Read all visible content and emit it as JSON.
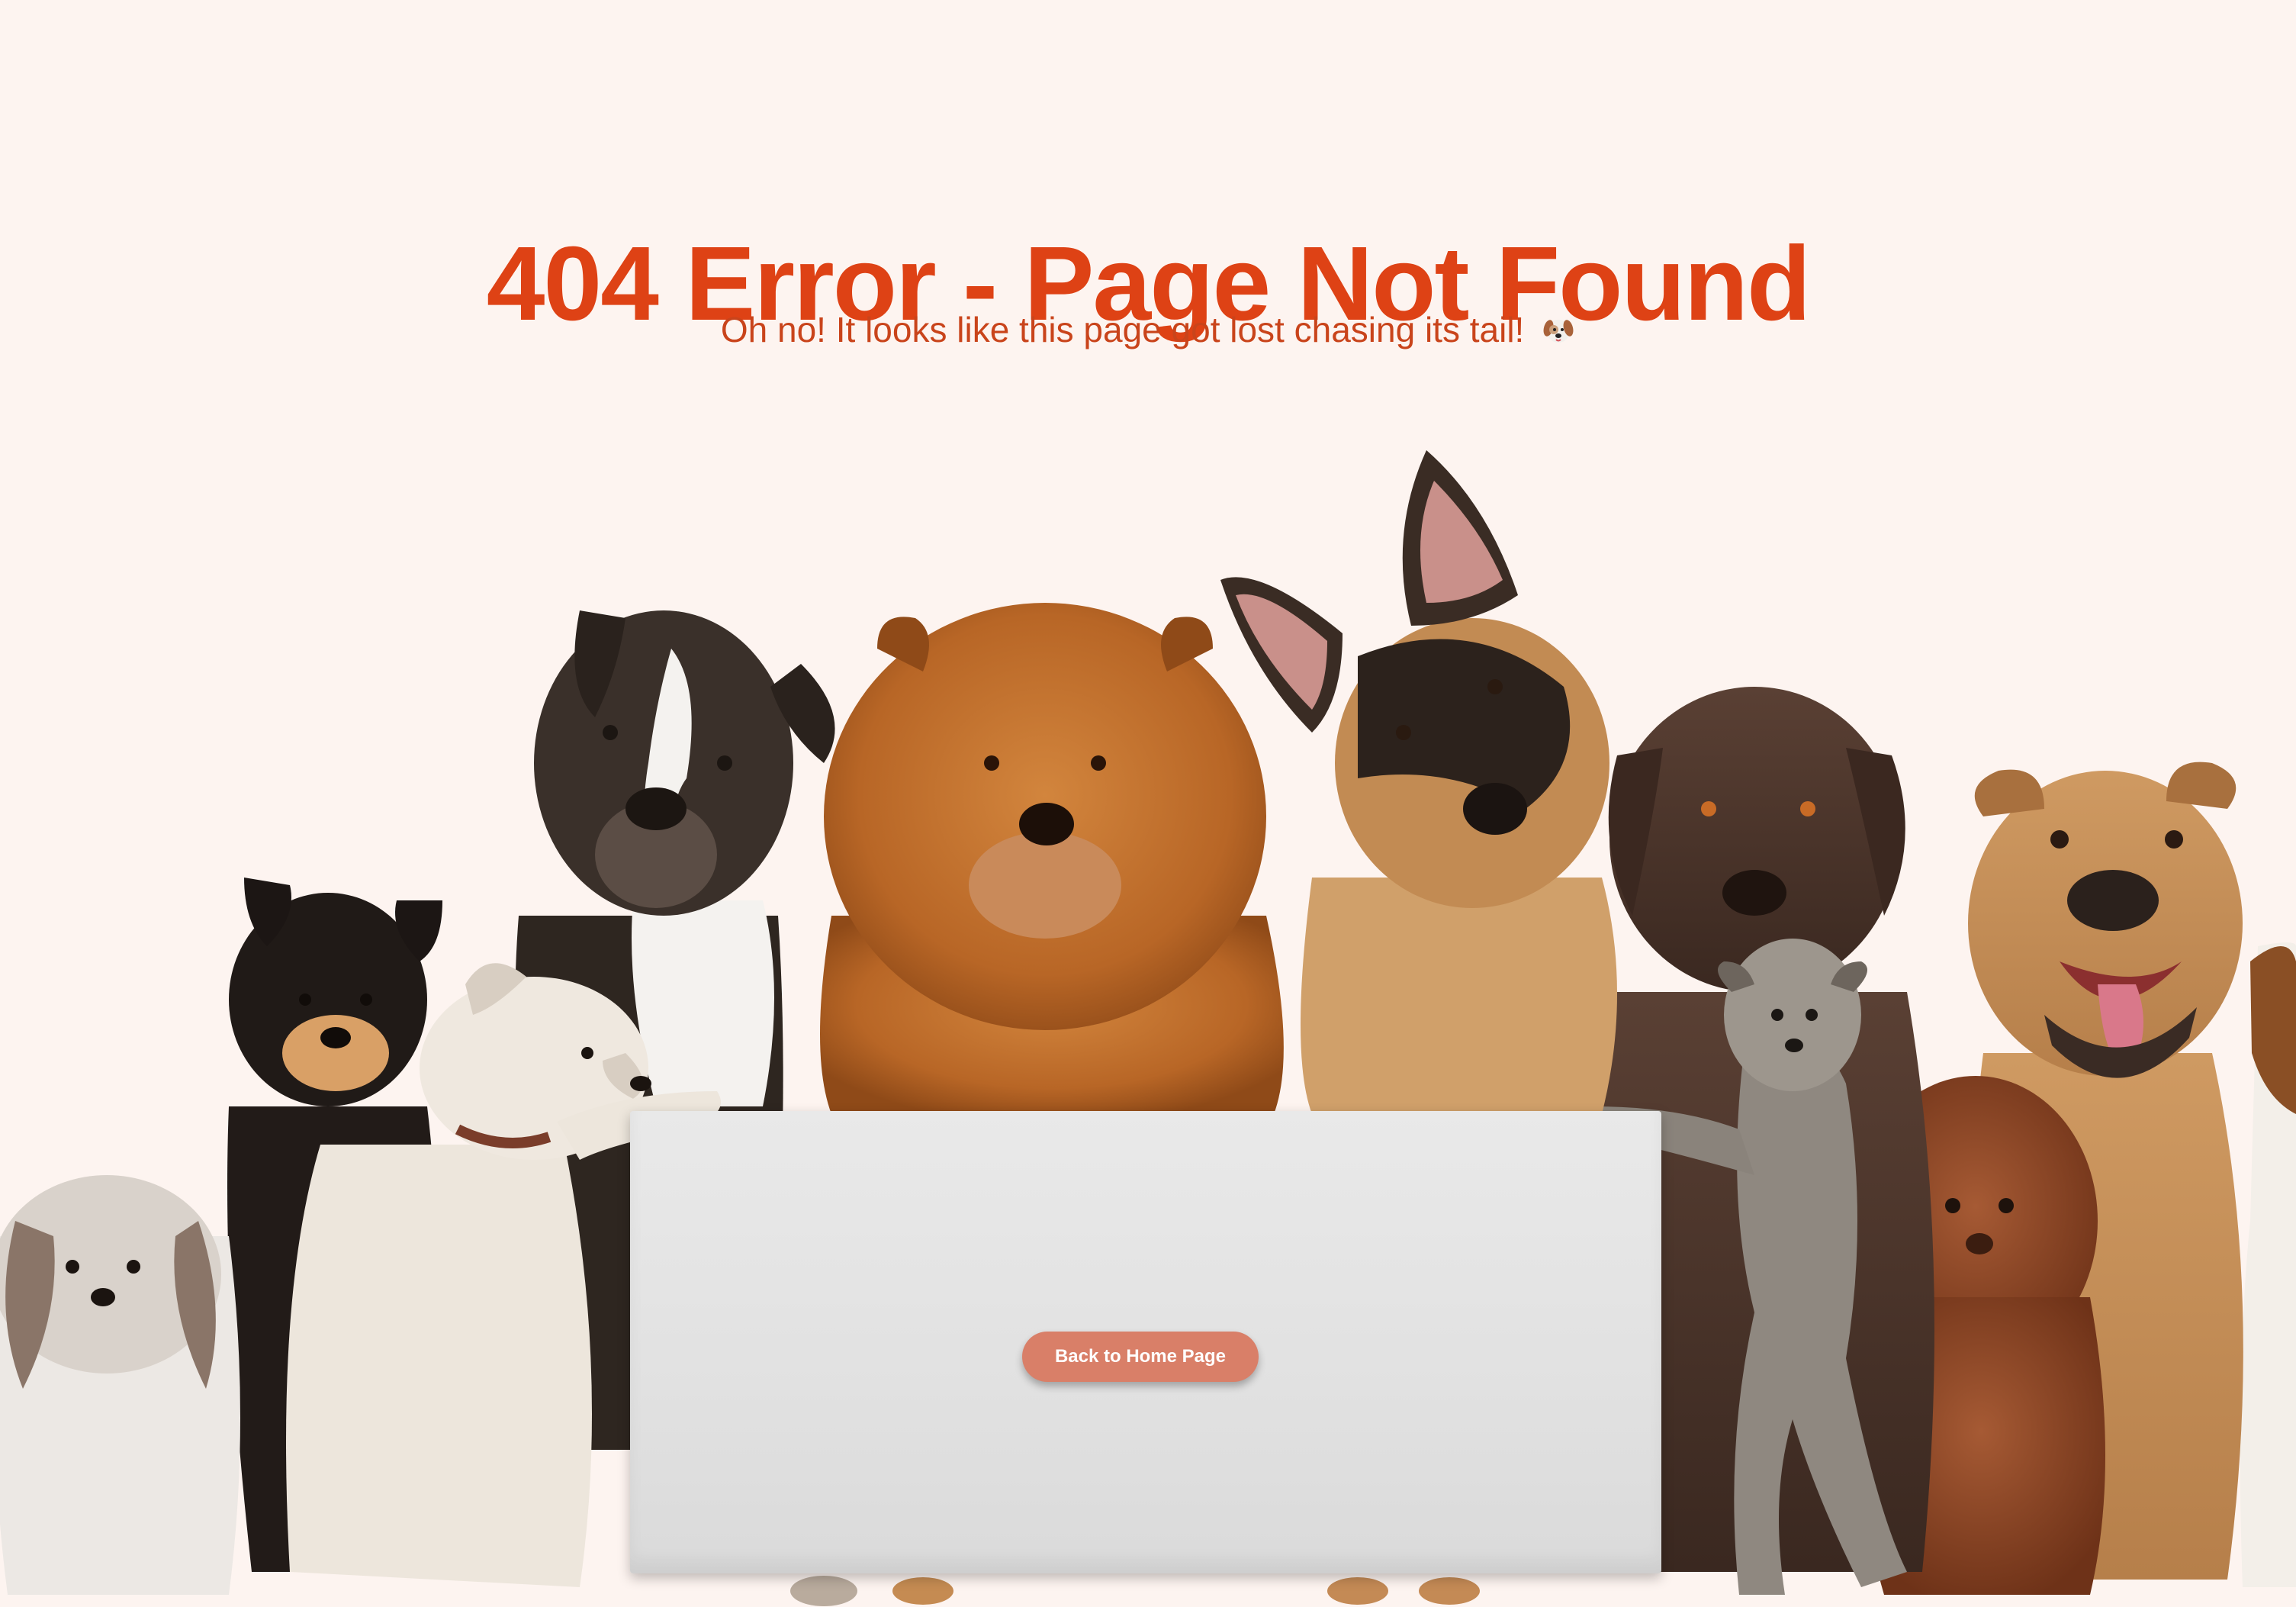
{
  "header": {
    "title": "404 Error - Page Not Found",
    "subtitle": "Oh no! It looks like this page got lost chasing its tail!",
    "subtitle_emoji": "dog-face-icon"
  },
  "sign": {
    "button_label": "Back to Home Page"
  },
  "illustration": {
    "dogs": [
      "shih-tzu",
      "shiba-inu",
      "white-mixed-dog",
      "boxer",
      "chow-chow",
      "german-shepherd",
      "labrador",
      "scruffy-terrier",
      "poodle",
      "pit-bull",
      "beagle"
    ]
  },
  "colors": {
    "background": "#fdf4f0",
    "title": "#de4215",
    "subtitle": "#c9441b",
    "button": "#d97f68",
    "sign": "#e4e4e4"
  }
}
